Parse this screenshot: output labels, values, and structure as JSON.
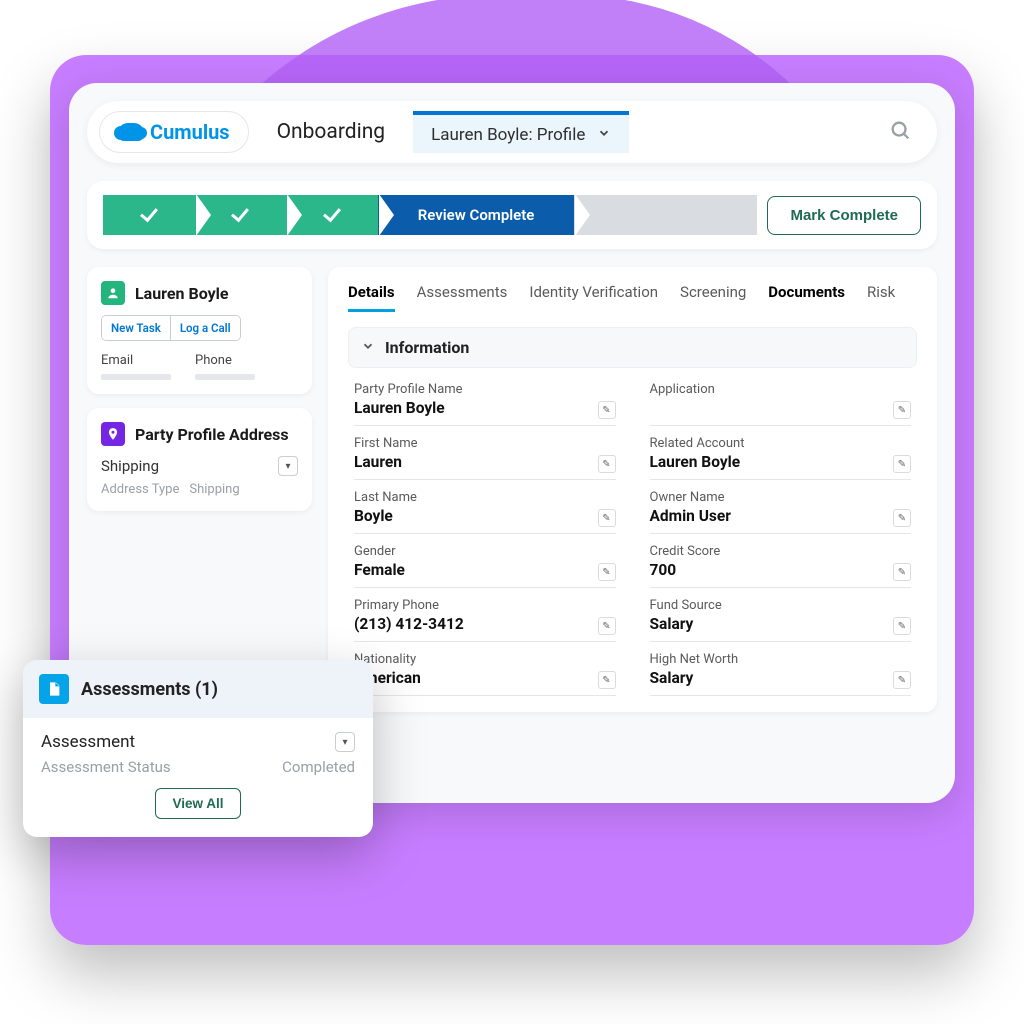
{
  "brand": "Cumulus",
  "context_label": "Onboarding",
  "active_tab_label": "Lauren Boyle: Profile",
  "path": {
    "current_label": "Review Complete",
    "action_label": "Mark Complete"
  },
  "profile_card": {
    "name": "Lauren Boyle",
    "new_task_label": "New Task",
    "log_call_label": "Log a Call",
    "email_label": "Email",
    "phone_label": "Phone"
  },
  "address_card": {
    "title": "Party Profile Address",
    "primary": "Shipping",
    "type_label": "Address Type",
    "type_value": "Shipping"
  },
  "assessments_card": {
    "title": "Assessments (1)",
    "item_label": "Assessment",
    "status_label": "Assessment Status",
    "status_value": "Completed",
    "view_all": "View All"
  },
  "detail_tabs": [
    "Details",
    "Assessments",
    "Identity Verification",
    "Screening",
    "Documents",
    "Risk"
  ],
  "section_title": "Information",
  "fields": {
    "left": [
      {
        "label": "Party Profile Name",
        "value": "Lauren Boyle"
      },
      {
        "label": "First Name",
        "value": "Lauren"
      },
      {
        "label": "Last Name",
        "value": "Boyle"
      },
      {
        "label": "Gender",
        "value": "Female"
      },
      {
        "label": "Primary Phone",
        "value": "(213) 412-3412"
      },
      {
        "label": "Nationality",
        "value": "American"
      }
    ],
    "right": [
      {
        "label": "Application",
        "value": ""
      },
      {
        "label": "Related Account",
        "value": "Lauren Boyle"
      },
      {
        "label": "Owner Name",
        "value": "Admin User"
      },
      {
        "label": "Credit Score",
        "value": "700"
      },
      {
        "label": "Fund Source",
        "value": "Salary"
      },
      {
        "label": "High Net Worth",
        "value": "Salary"
      }
    ]
  }
}
